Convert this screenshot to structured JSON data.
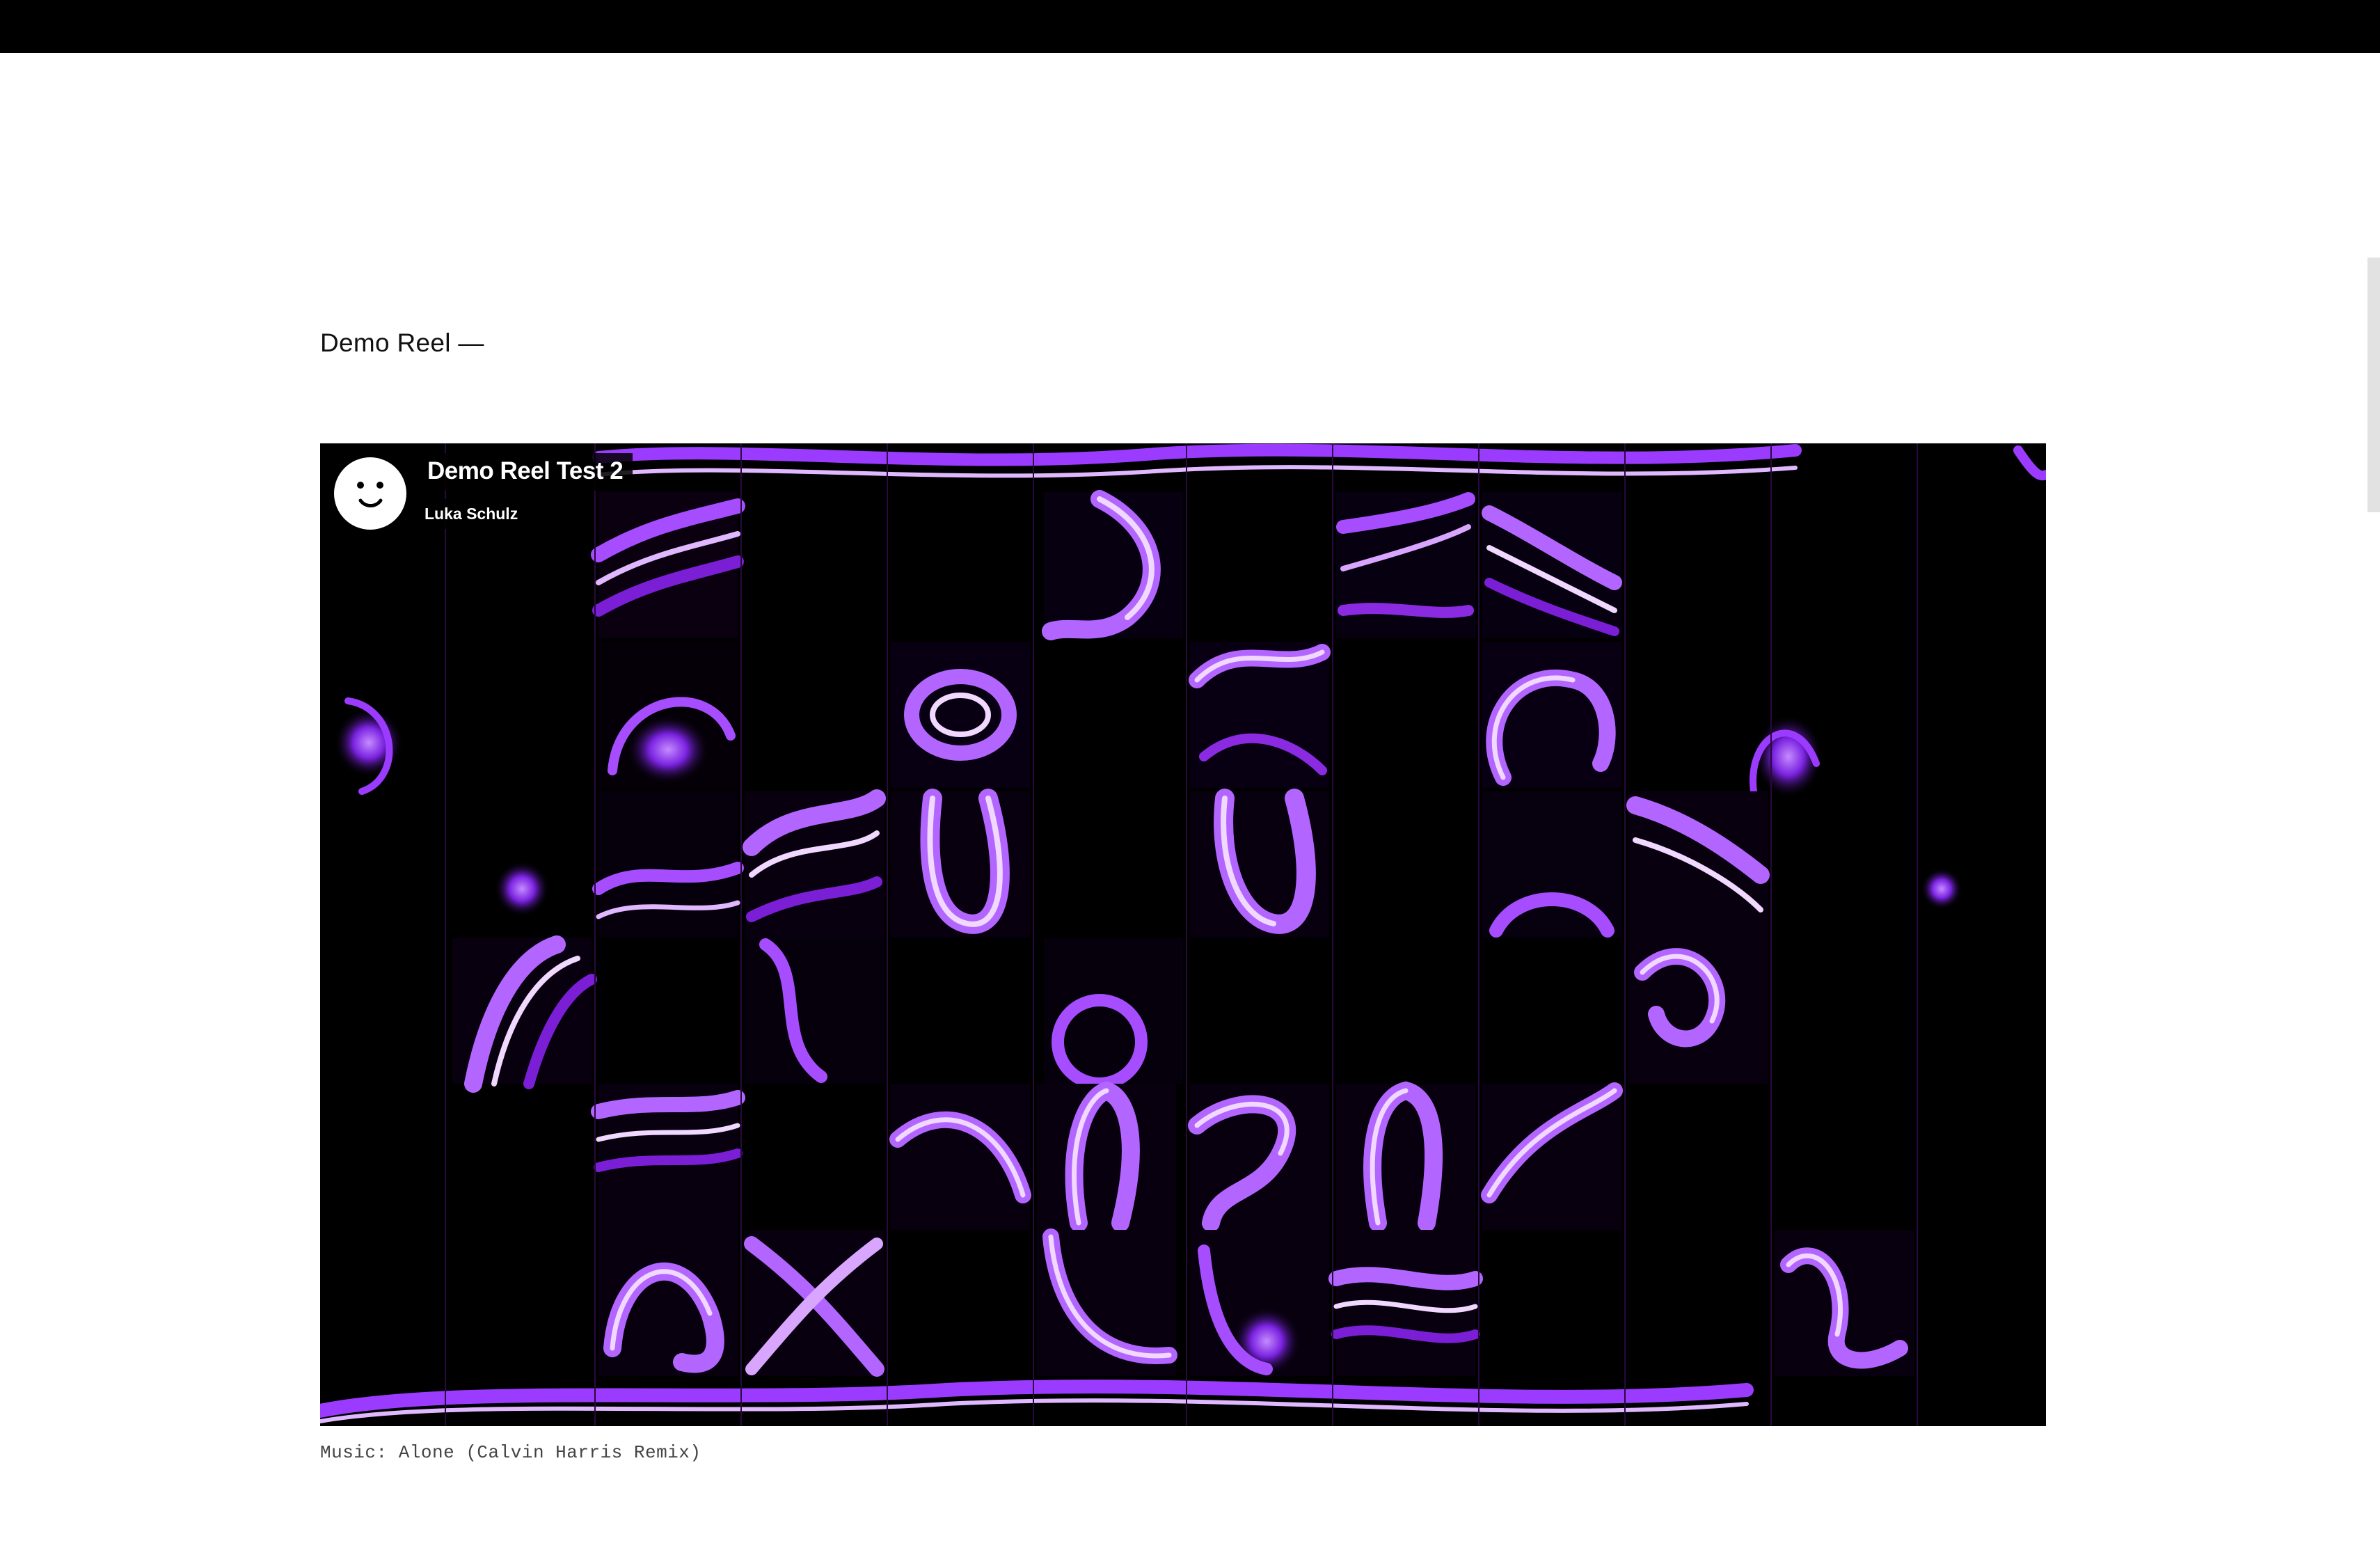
{
  "section": {
    "title": "Demo Reel —"
  },
  "video": {
    "title": "Demo Reel Test 2",
    "author": "Luka Schulz",
    "accent_color": "#9b3bff"
  },
  "caption": "Music: Alone (Calvin Harris Remix)",
  "icons": {
    "avatar": "smiley-face-icon"
  }
}
